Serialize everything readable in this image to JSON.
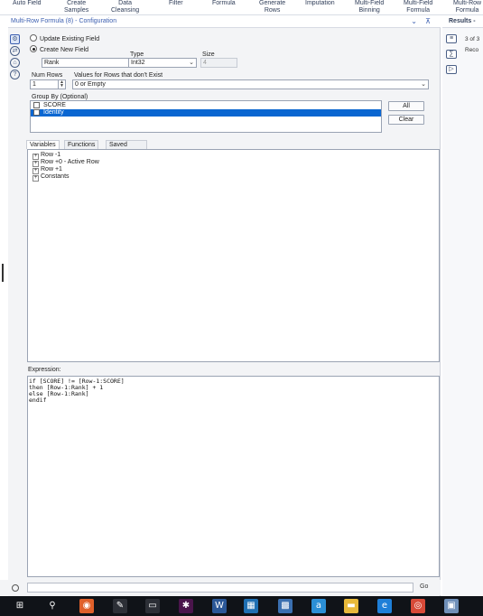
{
  "ribbon": {
    "tools": [
      "Auto Field",
      "Create\nSamples",
      "Data\nCleansing",
      "Filter",
      "Formula",
      "Generate\nRows",
      "Imputation",
      "Multi-Field\nBinning",
      "Multi-Field\nFormula",
      "Multi-Row\nFormula"
    ]
  },
  "config": {
    "title": "Multi-Row Formula (8) - Configuration",
    "update_existing_label": "Update Existing Field",
    "create_new_label": "Create New Field",
    "new_field_name": "Rank",
    "type_label": "Type",
    "type_value": "Int32",
    "size_label": "Size",
    "size_value": "4",
    "num_rows_label": "Num Rows",
    "num_rows_value": "1",
    "missing_rows_label": "Values for Rows that don't Exist",
    "missing_rows_value": "0 or Empty",
    "group_by_label": "Group By (Optional)",
    "group_by_items": [
      {
        "label": "SCORE",
        "selected": false
      },
      {
        "label": "Identity",
        "selected": true
      }
    ],
    "all_button": "All",
    "clear_button": "Clear"
  },
  "tabs": [
    "Variables",
    "Functions",
    "Saved Expressions"
  ],
  "variables": [
    "Row -1",
    "Row +0 - Active Row",
    "Row +1",
    "Constants"
  ],
  "expression": {
    "label": "Expression:",
    "text": "if [SCORE] != [Row-1:SCORE]\nthen [Row-1:Rank] + 1\nelse [Row-1:Rank]\nendif"
  },
  "status": {
    "go_label": "Go"
  },
  "results": {
    "title": "Results -",
    "count_text": "3 of 3",
    "record_label": "Reco"
  },
  "taskbar": {
    "icons": [
      {
        "name": "windows-start-icon",
        "glyph": "⊞",
        "color": "#101318"
      },
      {
        "name": "search-icon",
        "glyph": "⚲",
        "color": "#101318"
      },
      {
        "name": "alteryx-icon",
        "glyph": "◉",
        "color": "#e0602a"
      },
      {
        "name": "notepad-icon",
        "glyph": "✎",
        "color": "#2c2f36"
      },
      {
        "name": "terminal-icon",
        "glyph": "▭",
        "color": "#2c2f36"
      },
      {
        "name": "slack-icon",
        "glyph": "✱",
        "color": "#4a154b"
      },
      {
        "name": "word-icon",
        "glyph": "W",
        "color": "#2b5797"
      },
      {
        "name": "image-viewer-icon",
        "glyph": "▦",
        "color": "#1f6fb2"
      },
      {
        "name": "calculator-icon",
        "glyph": "▩",
        "color": "#3a6fb0"
      },
      {
        "name": "amazon-icon",
        "glyph": "a",
        "color": "#2b8fd6"
      },
      {
        "name": "file-explorer-icon",
        "glyph": "▬",
        "color": "#e8b93a"
      },
      {
        "name": "edge-icon",
        "glyph": "e",
        "color": "#1e7fd8"
      },
      {
        "name": "chrome-icon",
        "glyph": "◎",
        "color": "#d84a38"
      },
      {
        "name": "app-icon",
        "glyph": "▣",
        "color": "#6f8fb8"
      }
    ]
  }
}
